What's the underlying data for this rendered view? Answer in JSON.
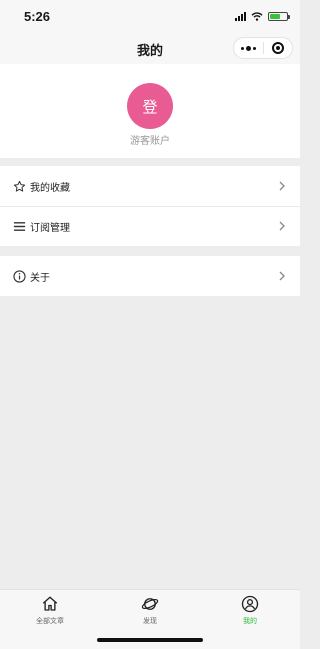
{
  "status_bar": {
    "time": "5:26",
    "battery_color": "#3ac33a"
  },
  "nav": {
    "title": "我的"
  },
  "profile": {
    "avatar_text": "登",
    "avatar_color": "#e95b93",
    "name": "游客账户"
  },
  "menu": [
    {
      "label": "我的收藏",
      "icon": "star-icon"
    },
    {
      "label": "订阅管理",
      "icon": "list-icon"
    },
    {
      "label": "关于",
      "icon": "info-icon"
    }
  ],
  "tab_bar": {
    "active_color": "#2dbb3c",
    "tabs": [
      {
        "label": "全部文章",
        "icon": "home-icon",
        "active": false
      },
      {
        "label": "发现",
        "icon": "planet-icon",
        "active": false
      },
      {
        "label": "我的",
        "icon": "user-icon",
        "active": true
      }
    ]
  }
}
